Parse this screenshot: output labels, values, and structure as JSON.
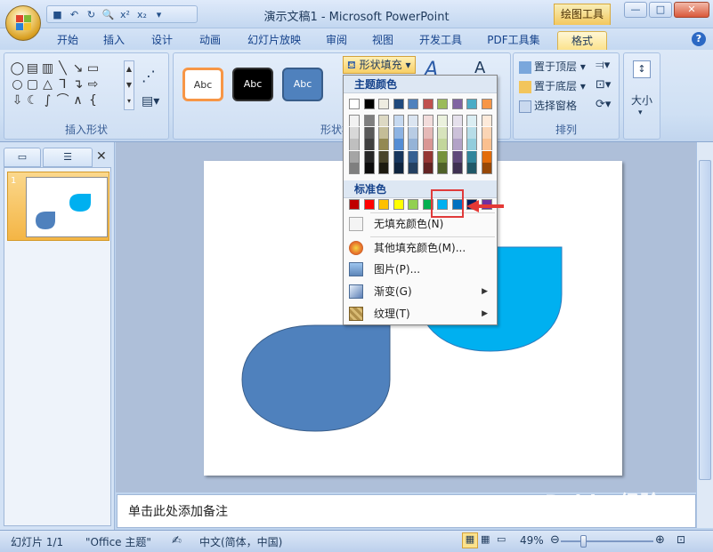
{
  "titlebar": {
    "title": "演示文稿1 - Microsoft PowerPoint",
    "context_tab": "绘图工具",
    "minimize": "—",
    "maximize": "□",
    "close": "✕"
  },
  "qat": {
    "icons": [
      "save-icon",
      "undo-icon",
      "redo-icon",
      "print-preview-icon",
      "x-squared-icon",
      "x-subscript-icon",
      "customize-icon"
    ]
  },
  "tabs": [
    "开始",
    "插入",
    "设计",
    "动画",
    "幻灯片放映",
    "审阅",
    "视图",
    "开发工具",
    "PDF工具集",
    "格式"
  ],
  "active_tab": "格式",
  "ribbon": {
    "groups": {
      "insert_shapes": "插入形状",
      "shape_styles": "形状样式",
      "arrange": "排列",
      "size": "大小"
    },
    "style_samples": [
      {
        "label": "Abc"
      },
      {
        "label": "Abc"
      },
      {
        "label": "Abc"
      }
    ],
    "fill_button": "形状填充",
    "bring_to_front": "置于顶层",
    "send_to_back": "置于底层",
    "selection_pane": "选择窗格"
  },
  "dropdown": {
    "theme_colors_label": "主题颜色",
    "standard_colors_label": "标准色",
    "theme_top_row": [
      "#ffffff",
      "#000000",
      "#eeece1",
      "#1f497d",
      "#4f81bd",
      "#c0504d",
      "#9bbb59",
      "#8064a2",
      "#4bacc6",
      "#f79646"
    ],
    "theme_shades": [
      [
        "#f2f2f2",
        "#7f7f7f",
        "#ddd9c3",
        "#c6d9f0",
        "#dbe5f1",
        "#f2dcdb",
        "#ebf1dd",
        "#e5e0ec",
        "#dbeef3",
        "#fdeada"
      ],
      [
        "#d8d8d8",
        "#595959",
        "#c4bd97",
        "#8db3e2",
        "#b8cce4",
        "#e5b9b7",
        "#d7e3bc",
        "#ccc1d9",
        "#b7dde8",
        "#fbd5b5"
      ],
      [
        "#bfbfbf",
        "#3f3f3f",
        "#938953",
        "#548dd4",
        "#95b3d7",
        "#d99694",
        "#c3d69b",
        "#b2a2c7",
        "#92cddc",
        "#fac08f"
      ],
      [
        "#a5a5a5",
        "#262626",
        "#494429",
        "#17365d",
        "#366092",
        "#953734",
        "#76923c",
        "#5f497a",
        "#31859b",
        "#e36c09"
      ],
      [
        "#7f7f7f",
        "#0c0c0c",
        "#1d1b10",
        "#0f243e",
        "#244061",
        "#632423",
        "#4f6128",
        "#3f3151",
        "#205867",
        "#974806"
      ]
    ],
    "standard_colors": [
      "#c00000",
      "#ff0000",
      "#ffc000",
      "#ffff00",
      "#92d050",
      "#00b050",
      "#00b0f0",
      "#0070c0",
      "#002060",
      "#7030a0"
    ],
    "selected_standard_index": 6,
    "items": [
      {
        "label": "无填充颜色(N)",
        "icon": "no-fill-icon"
      },
      {
        "label": "其他填充颜色(M)...",
        "icon": "palette-icon"
      },
      {
        "label": "图片(P)...",
        "icon": "picture-icon"
      },
      {
        "label": "渐变(G)",
        "icon": "gradient-icon",
        "submenu": true
      },
      {
        "label": "纹理(T)",
        "icon": "texture-icon",
        "submenu": true
      }
    ]
  },
  "slide_panel": {
    "slide_number": "1"
  },
  "slide_shapes": {
    "shape1_color": "#4f81bd",
    "shape2_color": "#00b0f0"
  },
  "notes": {
    "placeholder": "单击此处添加备注"
  },
  "status": {
    "slide_info": "幻灯片 1/1",
    "theme": "\"Office 主题\"",
    "language": "中文(简体，中国)",
    "zoom": "49%"
  },
  "watermark": "Baidu 经验"
}
